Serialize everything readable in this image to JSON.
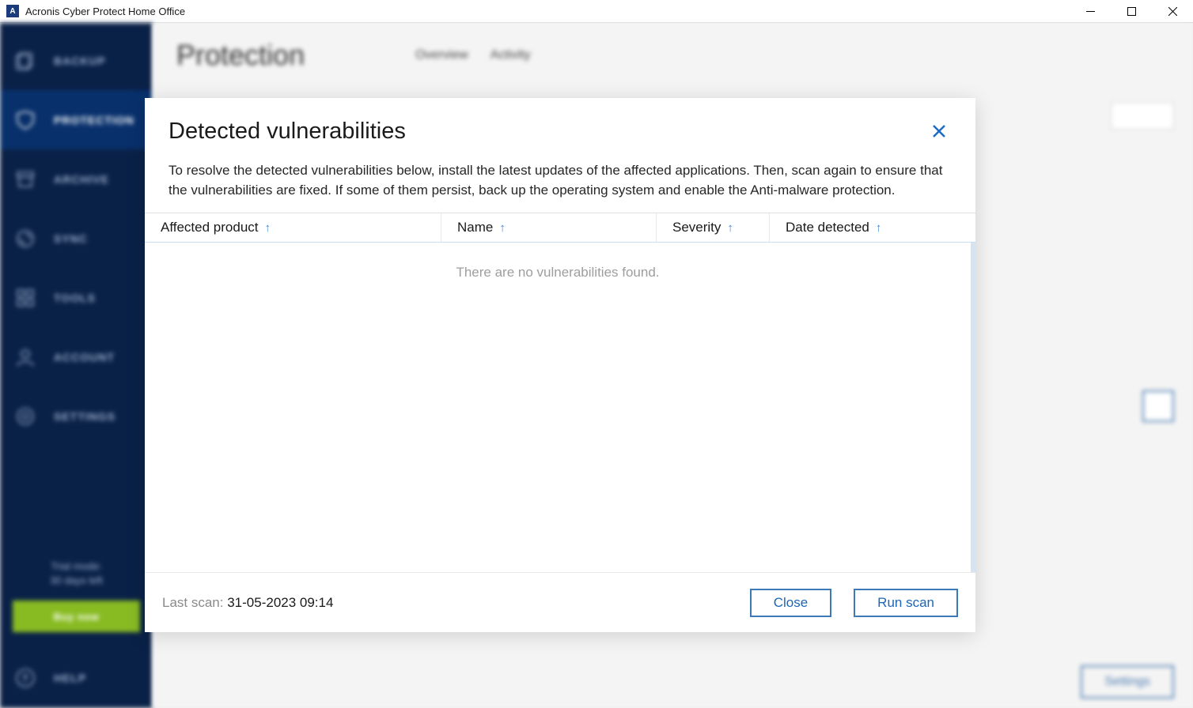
{
  "window": {
    "title": "Acronis Cyber Protect Home Office",
    "icon_letter": "A"
  },
  "sidebar": {
    "items": [
      {
        "label": "BACKUP"
      },
      {
        "label": "PROTECTION"
      },
      {
        "label": "ARCHIVE"
      },
      {
        "label": "SYNC"
      },
      {
        "label": "TOOLS"
      },
      {
        "label": "ACCOUNT"
      },
      {
        "label": "SETTINGS"
      }
    ],
    "promo_line1": "Trial mode:",
    "promo_line2": "30 days left",
    "buy_label": "Buy now",
    "help_label": "HELP"
  },
  "content": {
    "page_title": "Protection",
    "tabs": [
      "Overview",
      "Activity"
    ],
    "settings_label": "Settings"
  },
  "modal": {
    "title": "Detected vulnerabilities",
    "description": "To resolve the detected vulnerabilities below, install the latest updates of the affected applications. Then, scan again to ensure that the vulnerabilities are fixed. If some of them persist, back up the operating system and enable the Anti-malware protection.",
    "columns": {
      "product": "Affected product",
      "name": "Name",
      "severity": "Severity",
      "date": "Date detected"
    },
    "empty_message": "There are no vulnerabilities found.",
    "footer": {
      "last_scan_label": "Last scan: ",
      "last_scan_value": "31-05-2023 09:14",
      "close": "Close",
      "run": "Run scan"
    }
  }
}
